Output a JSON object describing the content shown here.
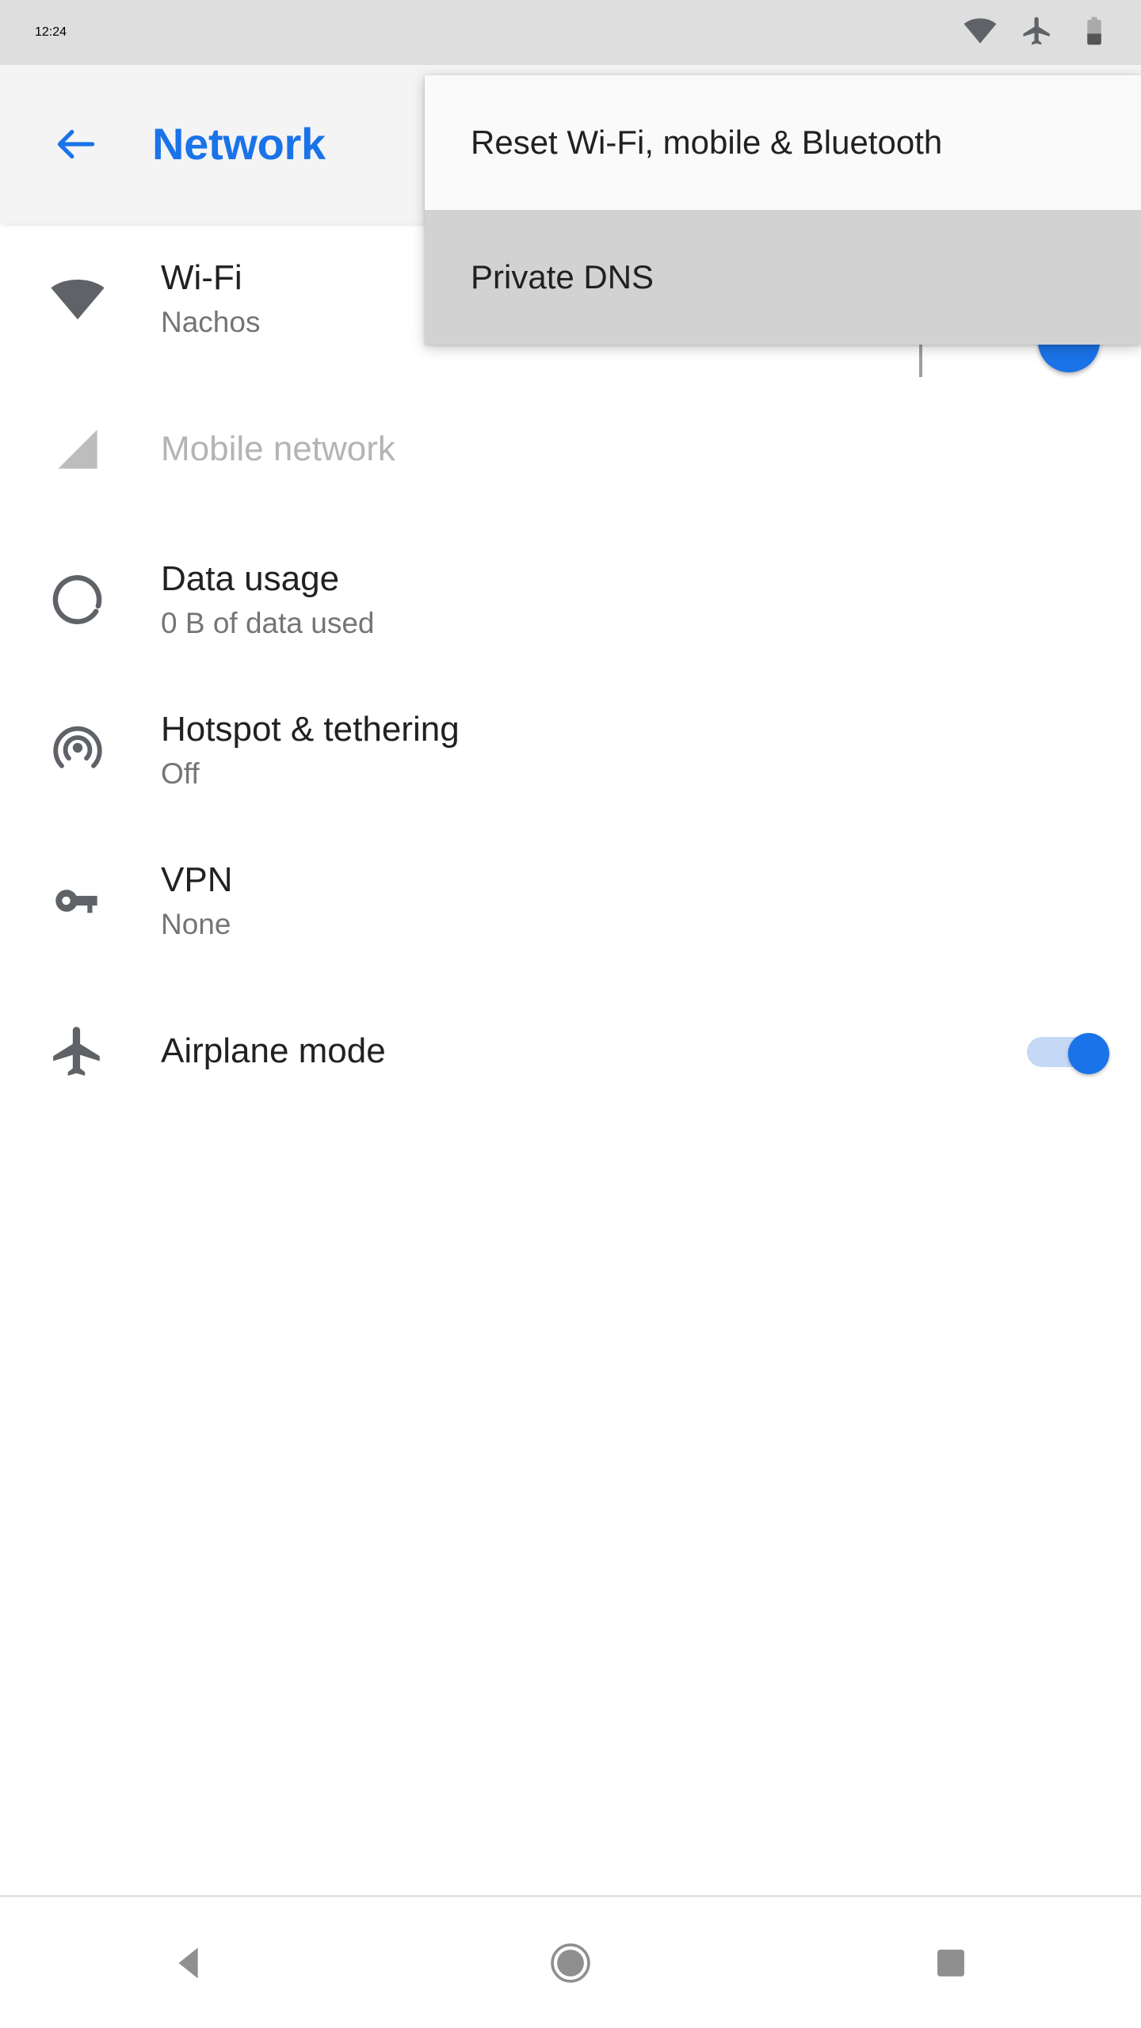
{
  "status_bar": {
    "time": "12:24",
    "icons": [
      {
        "name": "wifi-icon",
        "label": "Wi-Fi signal full"
      },
      {
        "name": "airplane-mode-icon",
        "label": "Airplane mode on"
      },
      {
        "name": "battery-icon",
        "label": "Battery 40 percent"
      }
    ],
    "battery_level_percent": 40,
    "background_color": "#dedede"
  },
  "app_bar": {
    "title": "Network",
    "title_color": "#1a73e8",
    "back_icon": "arrow-back-icon",
    "background_color": "#f4f4f4"
  },
  "settings": {
    "items": [
      {
        "icon": "wifi-icon",
        "title": "Wi-Fi",
        "subtitle": "Nachos",
        "disabled": false,
        "accessory": "toggle-hidden"
      },
      {
        "icon": "signal-cellular-icon",
        "title": "Mobile network",
        "subtitle": "",
        "disabled": true,
        "accessory": "none"
      },
      {
        "icon": "data-usage-icon",
        "title": "Data usage",
        "subtitle": "0 B of data used",
        "disabled": false,
        "accessory": "none"
      },
      {
        "icon": "hotspot-tethering-icon",
        "title": "Hotspot & tethering",
        "subtitle": "Off",
        "disabled": false,
        "accessory": "none"
      },
      {
        "icon": "vpn-key-icon",
        "title": "VPN",
        "subtitle": "None",
        "disabled": false,
        "accessory": "none"
      },
      {
        "icon": "airplane-mode-icon",
        "title": "Airplane mode",
        "subtitle": "",
        "disabled": false,
        "accessory": "toggle-on"
      }
    ]
  },
  "popup_menu": {
    "items": [
      {
        "label": "Reset Wi-Fi, mobile & Bluetooth",
        "highlighted": false
      },
      {
        "label": "Private DNS",
        "highlighted": true
      }
    ],
    "highlight_color": "#d2d2d2",
    "background_color": "#fafafa"
  },
  "nav_bar": {
    "buttons": [
      {
        "name": "nav-back-button",
        "label": "Back"
      },
      {
        "name": "nav-home-button",
        "label": "Home"
      },
      {
        "name": "nav-recents-button",
        "label": "Recents"
      }
    ]
  },
  "colors": {
    "accent_blue": "#1a73e8",
    "toggle_track": "#c5d9f7",
    "icon_gray": "#5f6368",
    "disabled_gray": "#b4b4b4",
    "secondary_text": "#757575"
  }
}
